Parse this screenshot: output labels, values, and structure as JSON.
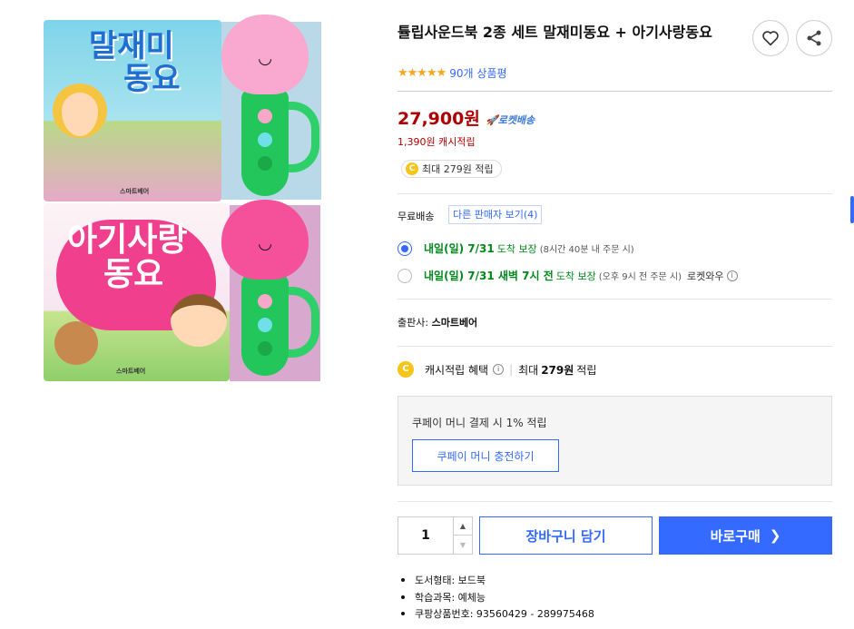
{
  "product": {
    "title": "튤립사운드북 2종 세트 말재미동요 + 아기사랑동요",
    "rating_stars": "★★★★★",
    "review_count": "90개 상품평"
  },
  "image": {
    "book1_title_l1": "말재미",
    "book1_title_l2": "동요",
    "book2_title_l1": "아기사랑",
    "book2_title_l2": "동요",
    "publisher_mark": "스마트베어",
    "mic_face": "◡"
  },
  "price": {
    "amount": "27,900원",
    "rocket_label": "🚀로켓배송",
    "cash_text": "1,390원 캐시적립",
    "cash_pill": "최대 279원 적립",
    "coin_letter": "C"
  },
  "shipping": {
    "label": "무료배송",
    "other_sellers": "다른 판매자 보기(4)",
    "option1": {
      "date": "내일(일) 7/31",
      "guarantee": "도착 보장",
      "note": "(8시간 40분 내 주문 시)"
    },
    "option2": {
      "date": "내일(일) 7/31 새벽 7시 전",
      "guarantee": "도착 보장",
      "note": "(오후 9시 전 주문 시)",
      "extra": "로켓와우",
      "info": "i"
    }
  },
  "publisher": {
    "label": "출판사:",
    "name": "스마트베어"
  },
  "benefit": {
    "label": "캐시적립 혜택",
    "info": "i",
    "sep": "|",
    "prefix": "최대",
    "amount": "279원",
    "suffix": "적립"
  },
  "coupay": {
    "text": "쿠페이 머니 결제 시 1% 적립",
    "button": "쿠페이 머니 충전하기"
  },
  "purchase": {
    "quantity": "1",
    "up": "▲",
    "down": "▼",
    "cart_button": "장바구니 담기",
    "buy_button": "바로구매",
    "buy_chevron": "❯"
  },
  "attributes": [
    "도서형태: 보드북",
    "학습과목: 예체능",
    "쿠팡상품번호: 93560429 - 289975468"
  ],
  "colors": {
    "accent": "#346aff",
    "price": "#ae0000",
    "delivery_green": "#00891a",
    "star": "#f5a623"
  }
}
